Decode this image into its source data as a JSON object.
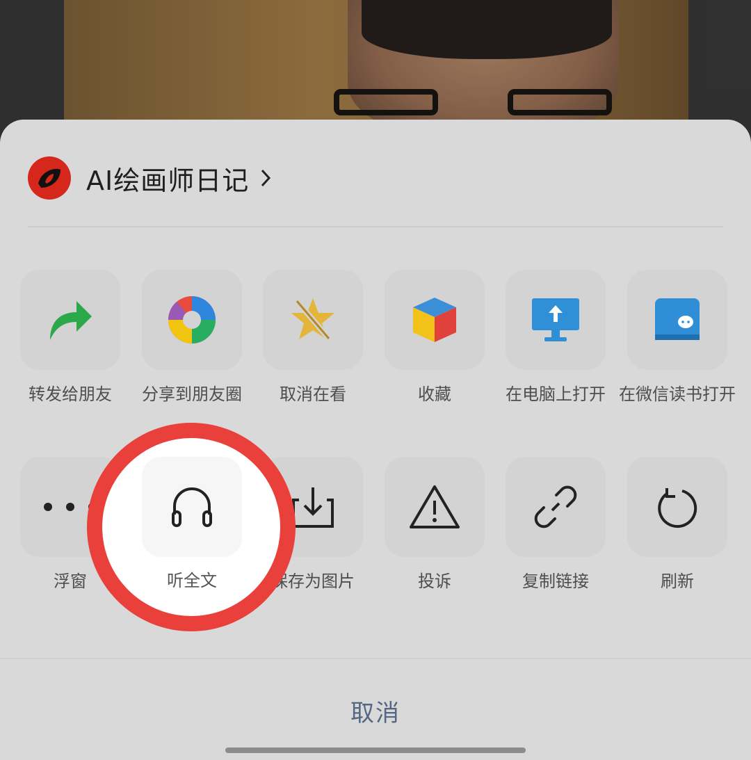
{
  "account": {
    "name": "AI绘画师日记"
  },
  "row1": [
    {
      "label": "转发给朋友",
      "icon": "forward-arrow-icon"
    },
    {
      "label": "分享到朋友圈",
      "icon": "moments-aperture-icon"
    },
    {
      "label": "取消在看",
      "icon": "unlike-star-icon"
    },
    {
      "label": "收藏",
      "icon": "favorite-cube-icon"
    },
    {
      "label": "在电脑上打开",
      "icon": "computer-upload-icon"
    },
    {
      "label": "在微信读书打开",
      "icon": "weread-book-icon"
    }
  ],
  "row2": [
    {
      "label": "浮窗",
      "icon": "more-dots-icon"
    },
    {
      "label": "听全文",
      "icon": "headphones-icon"
    },
    {
      "label": "保存为图片",
      "icon": "download-save-icon"
    },
    {
      "label": "投诉",
      "icon": "warning-triangle-icon"
    },
    {
      "label": "复制链接",
      "icon": "link-icon"
    },
    {
      "label": "刷新",
      "icon": "refresh-icon"
    }
  ],
  "cancel": "取消",
  "colors": {
    "highlight_ring": "#e9403b",
    "cancel_text": "#546782",
    "avatar": "#d6271c"
  }
}
